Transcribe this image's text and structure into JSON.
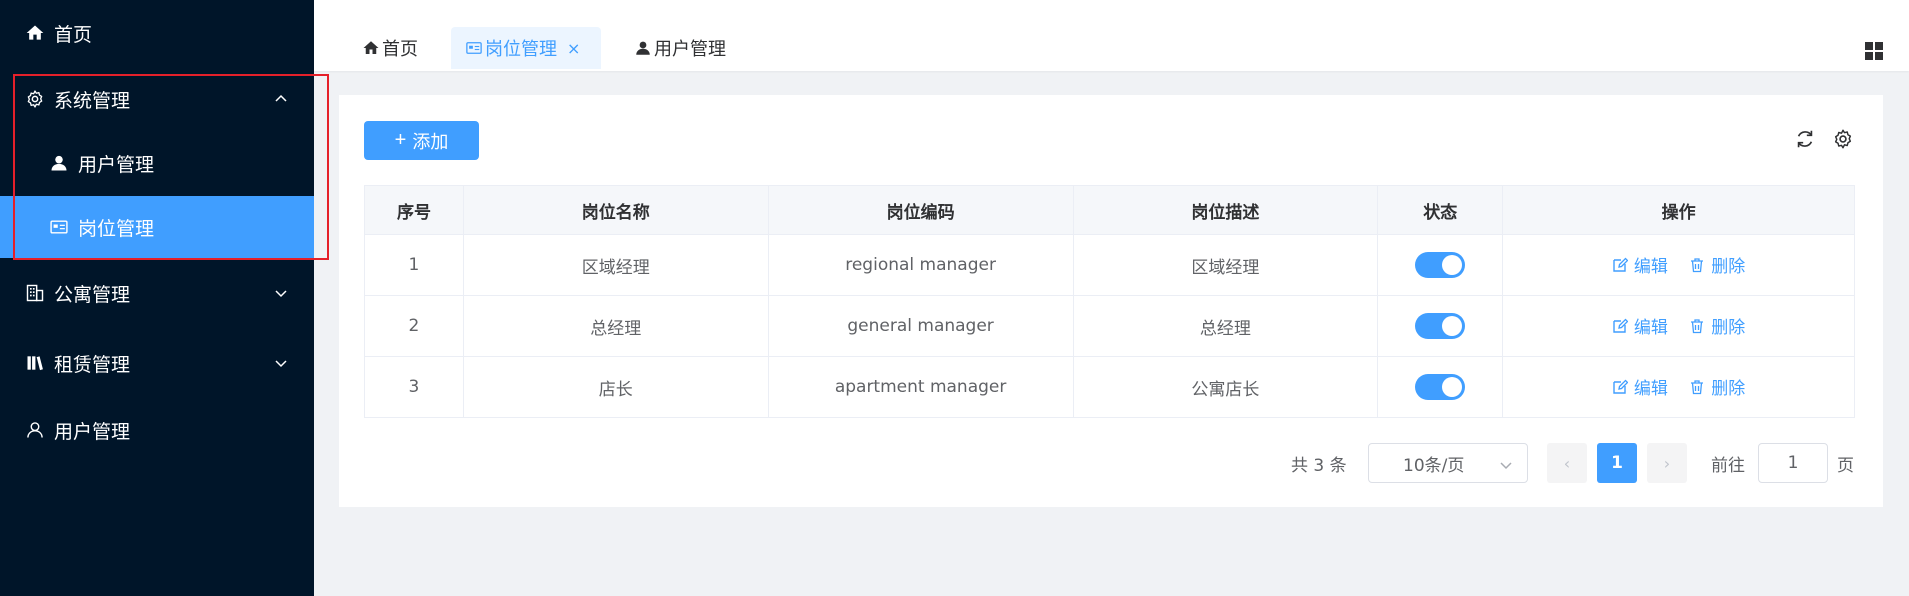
{
  "sidebar": {
    "items": [
      {
        "label": "首页",
        "icon": "home-icon"
      },
      {
        "label": "系统管理",
        "icon": "gear-icon",
        "expanded": true
      },
      {
        "label": "用户管理",
        "icon": "user-filled-icon"
      },
      {
        "label": "岗位管理",
        "icon": "id-card-icon",
        "active": true
      },
      {
        "label": "公寓管理",
        "icon": "building-icon"
      },
      {
        "label": "租赁管理",
        "icon": "books-icon"
      },
      {
        "label": "用户管理",
        "icon": "user-outline-icon"
      }
    ]
  },
  "tabs": [
    {
      "label": "首页",
      "icon": "home-icon"
    },
    {
      "label": "岗位管理",
      "icon": "id-card-icon",
      "active": true,
      "close": "×"
    },
    {
      "label": "用户管理",
      "icon": "user-filled-icon"
    }
  ],
  "toolbar": {
    "add_label": "添加",
    "add_plus": "+"
  },
  "table": {
    "headers": [
      "序号",
      "岗位名称",
      "岗位编码",
      "岗位描述",
      "状态",
      "操作"
    ],
    "rows": [
      {
        "index": "1",
        "name": "区域经理",
        "code": "regional manager",
        "desc": "区域经理",
        "status_on": true
      },
      {
        "index": "2",
        "name": "总经理",
        "code": "general manager",
        "desc": "总经理",
        "status_on": true
      },
      {
        "index": "3",
        "name": "店长",
        "code": "apartment manager",
        "desc": "公寓店长",
        "status_on": true
      }
    ],
    "edit_label": "编辑",
    "delete_label": "删除"
  },
  "pagination": {
    "total": "共 3 条",
    "page_size": "10条/页",
    "current_page": "1",
    "goto_label": "前往",
    "goto_value": "1",
    "page_suffix": "页",
    "prev": "‹",
    "next": "›"
  },
  "colors": {
    "sidebar_bg": "#001529",
    "accent": "#409eff",
    "highlight_border": "#e5202a"
  }
}
